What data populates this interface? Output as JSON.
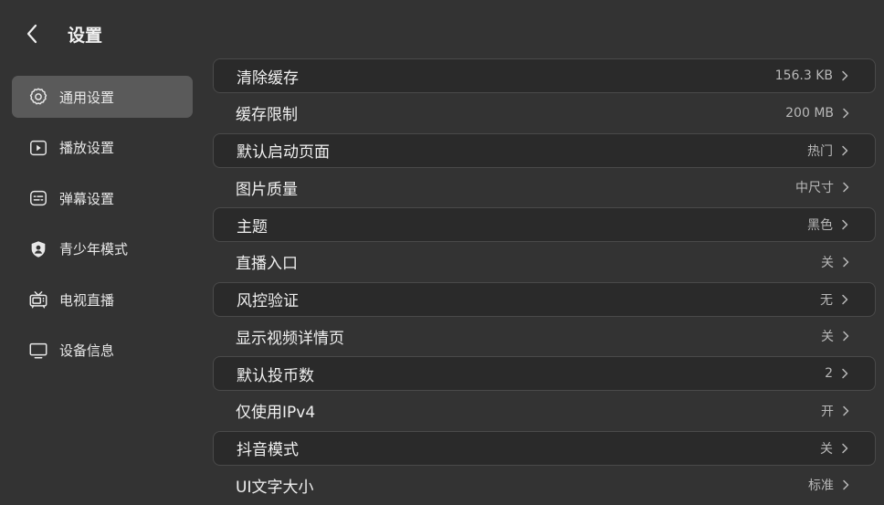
{
  "header": {
    "title": "设置",
    "back_icon": "chevron-left-icon"
  },
  "sidebar": {
    "items": [
      {
        "label": "通用设置",
        "icon": "gear-icon",
        "active": true
      },
      {
        "label": "播放设置",
        "icon": "play-icon",
        "active": false
      },
      {
        "label": "弹幕设置",
        "icon": "danmaku-icon",
        "active": false
      },
      {
        "label": "青少年模式",
        "icon": "shield-user-icon",
        "active": false
      },
      {
        "label": "电视直播",
        "icon": "tv-antenna-icon",
        "active": false
      },
      {
        "label": "设备信息",
        "icon": "monitor-icon",
        "active": false
      }
    ]
  },
  "settings": {
    "rows": [
      {
        "label": "清除缓存",
        "value": "156.3 KB"
      },
      {
        "label": "缓存限制",
        "value": "200 MB"
      },
      {
        "label": "默认启动页面",
        "value": "热门"
      },
      {
        "label": "图片质量",
        "value": "中尺寸"
      },
      {
        "label": "主题",
        "value": "黑色"
      },
      {
        "label": "直播入口",
        "value": "关"
      },
      {
        "label": "风控验证",
        "value": "无"
      },
      {
        "label": "显示视频详情页",
        "value": "关"
      },
      {
        "label": "默认投币数",
        "value": "2"
      },
      {
        "label": "仅使用IPv4",
        "value": "开"
      },
      {
        "label": "抖音模式",
        "value": "关"
      },
      {
        "label": "UI文字大小",
        "value": "标准"
      }
    ]
  },
  "colors": {
    "background": "#333333",
    "active_sidebar": "#5a5a5a",
    "boxed_row": "#2a2a2a",
    "text": "#f0f0f0",
    "muted_text": "#b8b8b8"
  }
}
